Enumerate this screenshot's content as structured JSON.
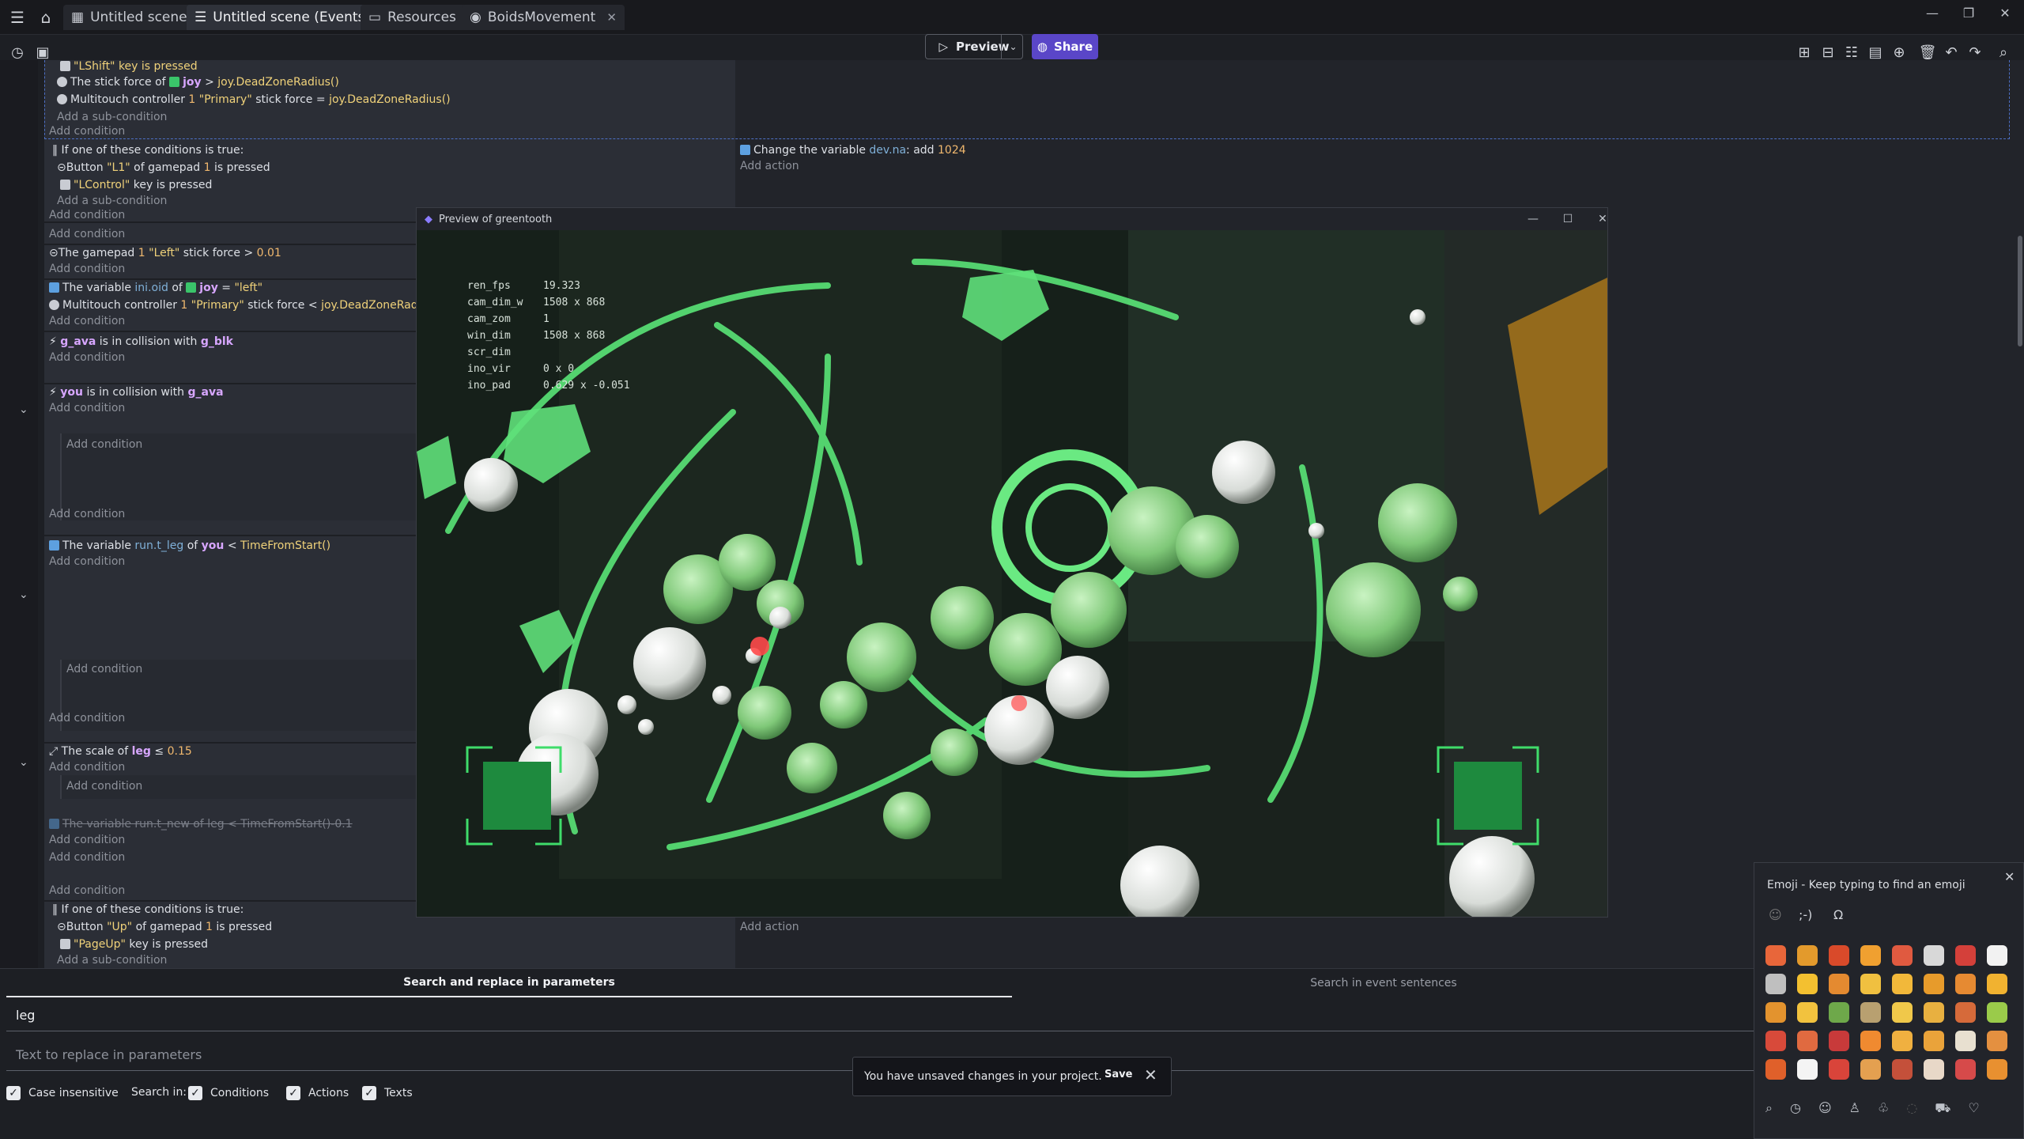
{
  "tabs": [
    {
      "label": "Untitled scene"
    },
    {
      "label": "Untitled scene (Events)"
    },
    {
      "label": "Resources"
    },
    {
      "label": "BoidsMovement"
    }
  ],
  "toolbar": {
    "preview_label": "Preview",
    "share_label": "Share"
  },
  "events": {
    "r1": "\"LShift\" key is pressed",
    "r2a": "The stick force of",
    "r2b": "joy",
    "r2c": ">",
    "r2d": "joy.DeadZoneRadius()",
    "r3a": "Multitouch controller",
    "r3b": "1",
    "r3c": "\"Primary\"",
    "r3d": "stick force =",
    "r3e": "joy.DeadZoneRadius()",
    "add_sub": "Add a sub-condition",
    "add_cond": "Add condition",
    "add_action": "Add action",
    "or_title": "If one of these conditions is true:",
    "r5a": "Button",
    "r5b": "\"L1\"",
    "r5c": "of gamepad",
    "r5d": "1",
    "r5e": "is pressed",
    "r6a": "\"LControl\"",
    "r6b": "key is pressed",
    "act1a": "Change the variable",
    "act1b": "dev.na",
    "act1c": ": add",
    "act1d": "1024",
    "r7a": "The gamepad",
    "r7b": "1",
    "r7c": "\"Left\"",
    "r7d": "stick force",
    "r7e": ">",
    "r7f": "0.01",
    "r8a": "The variable",
    "r8b": "ini.oid",
    "r8c": "of",
    "r8d": "joy",
    "r8e": "=",
    "r8f": "\"left\"",
    "r9a": "Multitouch controller",
    "r9b": "1",
    "r9c": "\"Primary\"",
    "r9d": "stick force <",
    "r9e": "joy.DeadZoneRadius()",
    "r10a": "g_ava",
    "r10b": "is in collision with",
    "r10c": "g_blk",
    "r11a": "you",
    "r11b": "is in collision with",
    "r11c": "g_ava",
    "r12a": "The variable",
    "r12b": "run.t_leg",
    "r12c": "of",
    "r12d": "you",
    "r12e": "<",
    "r12f": "TimeFromStart()",
    "r13a": "The scale of",
    "r13b": "leg",
    "r13c": "≤",
    "r13d": "0.15",
    "r14": "The variable run.t_new of leg < TimeFromStart()-0.1",
    "r15a": "Button",
    "r15b": "\"Up\"",
    "r15c": "of gamepad",
    "r15d": "1",
    "r15e": "is pressed",
    "r16a": "\"PageUp\"",
    "r16b": "key is pressed"
  },
  "preview_window": {
    "title": "Preview of greentooth",
    "debug": [
      {
        "k": "ren_fps",
        "v": "19.323"
      },
      {
        "k": "cam_dim_w",
        "v": "1508 x 868"
      },
      {
        "k": "cam_zom",
        "v": "1"
      },
      {
        "k": "win_dim",
        "v": "1508 x 868"
      },
      {
        "k": "scr_dim",
        "v": ""
      },
      {
        "k": "ino_vir",
        "v": "0 x 0"
      },
      {
        "k": "ino_pad",
        "v": "0.629 x -0.051"
      }
    ]
  },
  "search": {
    "tab_params": "Search and replace in parameters",
    "tab_sentences": "Search in event sentences",
    "query": "leg",
    "replace_placeholder": "Text to replace in parameters",
    "case_label": "Case insensitive",
    "search_in": "Search in:",
    "conditions_label": "Conditions",
    "actions_label": "Actions",
    "texts_label": "Texts"
  },
  "toast": {
    "message": "You have unsaved changes in your project.",
    "save_label": "Save"
  },
  "emoji_picker": {
    "title": "Emoji - Keep typing to find an emoji"
  },
  "colors": {
    "accent": "#5a46c8",
    "game_green": "#3ee46a",
    "dash_border": "#4d6fc4"
  },
  "icons": [
    "menu-icon",
    "home-icon",
    "scene-icon",
    "events-icon",
    "resources-icon",
    "extension-icon",
    "history-icon",
    "project-icon",
    "play-icon",
    "globe-icon",
    "undo-icon",
    "redo-icon",
    "search-icon",
    "trash-icon",
    "close-icon",
    "minimize-icon",
    "maximize-icon"
  ]
}
